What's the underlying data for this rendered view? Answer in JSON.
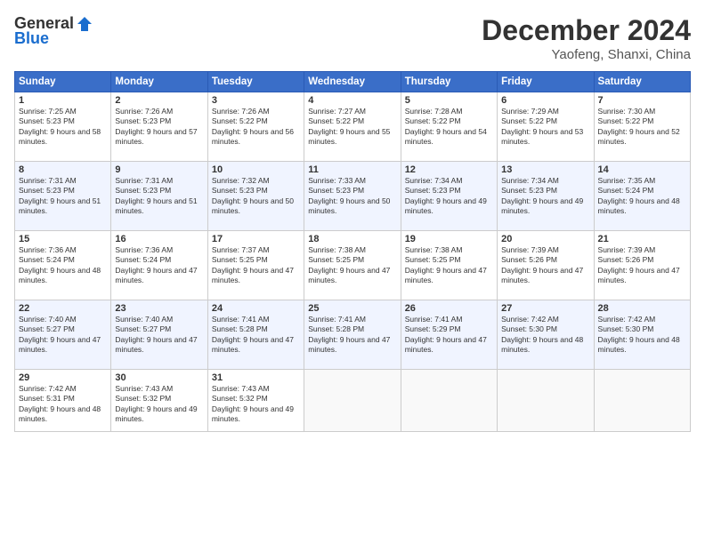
{
  "header": {
    "logo_general": "General",
    "logo_blue": "Blue",
    "month_title": "December 2024",
    "location": "Yaofeng, Shanxi, China"
  },
  "weekdays": [
    "Sunday",
    "Monday",
    "Tuesday",
    "Wednesday",
    "Thursday",
    "Friday",
    "Saturday"
  ],
  "weeks": [
    [
      {
        "day": 1,
        "sunrise": "7:25 AM",
        "sunset": "5:23 PM",
        "daylight": "9 hours and 58 minutes."
      },
      {
        "day": 2,
        "sunrise": "7:26 AM",
        "sunset": "5:23 PM",
        "daylight": "9 hours and 57 minutes."
      },
      {
        "day": 3,
        "sunrise": "7:26 AM",
        "sunset": "5:22 PM",
        "daylight": "9 hours and 56 minutes."
      },
      {
        "day": 4,
        "sunrise": "7:27 AM",
        "sunset": "5:22 PM",
        "daylight": "9 hours and 55 minutes."
      },
      {
        "day": 5,
        "sunrise": "7:28 AM",
        "sunset": "5:22 PM",
        "daylight": "9 hours and 54 minutes."
      },
      {
        "day": 6,
        "sunrise": "7:29 AM",
        "sunset": "5:22 PM",
        "daylight": "9 hours and 53 minutes."
      },
      {
        "day": 7,
        "sunrise": "7:30 AM",
        "sunset": "5:22 PM",
        "daylight": "9 hours and 52 minutes."
      }
    ],
    [
      {
        "day": 8,
        "sunrise": "7:31 AM",
        "sunset": "5:23 PM",
        "daylight": "9 hours and 51 minutes."
      },
      {
        "day": 9,
        "sunrise": "7:31 AM",
        "sunset": "5:23 PM",
        "daylight": "9 hours and 51 minutes."
      },
      {
        "day": 10,
        "sunrise": "7:32 AM",
        "sunset": "5:23 PM",
        "daylight": "9 hours and 50 minutes."
      },
      {
        "day": 11,
        "sunrise": "7:33 AM",
        "sunset": "5:23 PM",
        "daylight": "9 hours and 50 minutes."
      },
      {
        "day": 12,
        "sunrise": "7:34 AM",
        "sunset": "5:23 PM",
        "daylight": "9 hours and 49 minutes."
      },
      {
        "day": 13,
        "sunrise": "7:34 AM",
        "sunset": "5:23 PM",
        "daylight": "9 hours and 49 minutes."
      },
      {
        "day": 14,
        "sunrise": "7:35 AM",
        "sunset": "5:24 PM",
        "daylight": "9 hours and 48 minutes."
      }
    ],
    [
      {
        "day": 15,
        "sunrise": "7:36 AM",
        "sunset": "5:24 PM",
        "daylight": "9 hours and 48 minutes."
      },
      {
        "day": 16,
        "sunrise": "7:36 AM",
        "sunset": "5:24 PM",
        "daylight": "9 hours and 47 minutes."
      },
      {
        "day": 17,
        "sunrise": "7:37 AM",
        "sunset": "5:25 PM",
        "daylight": "9 hours and 47 minutes."
      },
      {
        "day": 18,
        "sunrise": "7:38 AM",
        "sunset": "5:25 PM",
        "daylight": "9 hours and 47 minutes."
      },
      {
        "day": 19,
        "sunrise": "7:38 AM",
        "sunset": "5:25 PM",
        "daylight": "9 hours and 47 minutes."
      },
      {
        "day": 20,
        "sunrise": "7:39 AM",
        "sunset": "5:26 PM",
        "daylight": "9 hours and 47 minutes."
      },
      {
        "day": 21,
        "sunrise": "7:39 AM",
        "sunset": "5:26 PM",
        "daylight": "9 hours and 47 minutes."
      }
    ],
    [
      {
        "day": 22,
        "sunrise": "7:40 AM",
        "sunset": "5:27 PM",
        "daylight": "9 hours and 47 minutes."
      },
      {
        "day": 23,
        "sunrise": "7:40 AM",
        "sunset": "5:27 PM",
        "daylight": "9 hours and 47 minutes."
      },
      {
        "day": 24,
        "sunrise": "7:41 AM",
        "sunset": "5:28 PM",
        "daylight": "9 hours and 47 minutes."
      },
      {
        "day": 25,
        "sunrise": "7:41 AM",
        "sunset": "5:28 PM",
        "daylight": "9 hours and 47 minutes."
      },
      {
        "day": 26,
        "sunrise": "7:41 AM",
        "sunset": "5:29 PM",
        "daylight": "9 hours and 47 minutes."
      },
      {
        "day": 27,
        "sunrise": "7:42 AM",
        "sunset": "5:30 PM",
        "daylight": "9 hours and 48 minutes."
      },
      {
        "day": 28,
        "sunrise": "7:42 AM",
        "sunset": "5:30 PM",
        "daylight": "9 hours and 48 minutes."
      }
    ],
    [
      {
        "day": 29,
        "sunrise": "7:42 AM",
        "sunset": "5:31 PM",
        "daylight": "9 hours and 48 minutes."
      },
      {
        "day": 30,
        "sunrise": "7:43 AM",
        "sunset": "5:32 PM",
        "daylight": "9 hours and 49 minutes."
      },
      {
        "day": 31,
        "sunrise": "7:43 AM",
        "sunset": "5:32 PM",
        "daylight": "9 hours and 49 minutes."
      },
      null,
      null,
      null,
      null
    ]
  ]
}
